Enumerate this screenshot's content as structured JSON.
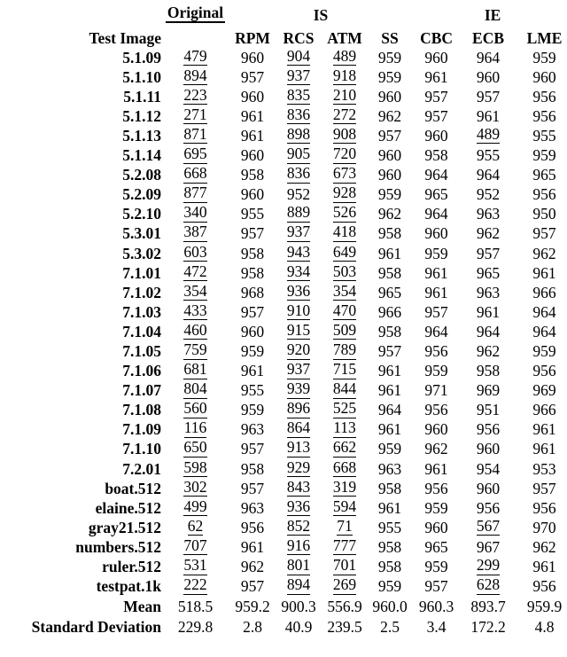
{
  "table": {
    "row_header_label": "Test Image",
    "group_headers": [
      {
        "key": "original",
        "label": "Original",
        "span": 1,
        "underlined": true
      },
      {
        "key": "is",
        "label": "IS",
        "span": 4,
        "underlined": false
      },
      {
        "key": "ie",
        "label": "IE",
        "span": 3,
        "underlined": false
      }
    ],
    "columns": [
      {
        "key": "original",
        "label": ""
      },
      {
        "key": "rpm",
        "label": "RPM"
      },
      {
        "key": "rcs",
        "label": "RCS"
      },
      {
        "key": "atm",
        "label": "ATM"
      },
      {
        "key": "ss",
        "label": "SS"
      },
      {
        "key": "cbc",
        "label": "CBC"
      },
      {
        "key": "ecb",
        "label": "ECB"
      },
      {
        "key": "lme",
        "label": "LME"
      }
    ],
    "rows": [
      {
        "name": "5.1.09",
        "original": "479",
        "rpm": "960",
        "rcs": "904",
        "atm": "489",
        "ss": "959",
        "cbc": "960",
        "ecb": "964",
        "lme": "959"
      },
      {
        "name": "5.1.10",
        "original": "894",
        "rpm": "957",
        "rcs": "937",
        "atm": "918",
        "ss": "959",
        "cbc": "961",
        "ecb": "960",
        "lme": "960"
      },
      {
        "name": "5.1.11",
        "original": "223",
        "rpm": "960",
        "rcs": "835",
        "atm": "210",
        "ss": "960",
        "cbc": "957",
        "ecb": "957",
        "lme": "956"
      },
      {
        "name": "5.1.12",
        "original": "271",
        "rpm": "961",
        "rcs": "836",
        "atm": "272",
        "ss": "962",
        "cbc": "957",
        "ecb": "961",
        "lme": "956"
      },
      {
        "name": "5.1.13",
        "original": "871",
        "rpm": "961",
        "rcs": "898",
        "atm": "908",
        "ss": "957",
        "cbc": "960",
        "ecb": "489",
        "lme": "955"
      },
      {
        "name": "5.1.14",
        "original": "695",
        "rpm": "960",
        "rcs": "905",
        "atm": "720",
        "ss": "960",
        "cbc": "958",
        "ecb": "955",
        "lme": "959"
      },
      {
        "name": "5.2.08",
        "original": "668",
        "rpm": "958",
        "rcs": "836",
        "atm": "673",
        "ss": "960",
        "cbc": "964",
        "ecb": "964",
        "lme": "965"
      },
      {
        "name": "5.2.09",
        "original": "877",
        "rpm": "960",
        "rcs": "952",
        "atm": "928",
        "ss": "959",
        "cbc": "965",
        "ecb": "952",
        "lme": "956"
      },
      {
        "name": "5.2.10",
        "original": "340",
        "rpm": "955",
        "rcs": "889",
        "atm": "526",
        "ss": "962",
        "cbc": "964",
        "ecb": "963",
        "lme": "950"
      },
      {
        "name": "5.3.01",
        "original": "387",
        "rpm": "957",
        "rcs": "937",
        "atm": "418",
        "ss": "958",
        "cbc": "960",
        "ecb": "962",
        "lme": "957"
      },
      {
        "name": "5.3.02",
        "original": "603",
        "rpm": "958",
        "rcs": "943",
        "atm": "649",
        "ss": "961",
        "cbc": "959",
        "ecb": "957",
        "lme": "962"
      },
      {
        "name": "7.1.01",
        "original": "472",
        "rpm": "958",
        "rcs": "934",
        "atm": "503",
        "ss": "958",
        "cbc": "961",
        "ecb": "965",
        "lme": "961"
      },
      {
        "name": "7.1.02",
        "original": "354",
        "rpm": "968",
        "rcs": "936",
        "atm": "354",
        "ss": "965",
        "cbc": "961",
        "ecb": "963",
        "lme": "966"
      },
      {
        "name": "7.1.03",
        "original": "433",
        "rpm": "957",
        "rcs": "910",
        "atm": "470",
        "ss": "966",
        "cbc": "957",
        "ecb": "961",
        "lme": "964"
      },
      {
        "name": "7.1.04",
        "original": "460",
        "rpm": "960",
        "rcs": "915",
        "atm": "509",
        "ss": "958",
        "cbc": "964",
        "ecb": "964",
        "lme": "964"
      },
      {
        "name": "7.1.05",
        "original": "759",
        "rpm": "959",
        "rcs": "920",
        "atm": "789",
        "ss": "957",
        "cbc": "956",
        "ecb": "962",
        "lme": "959"
      },
      {
        "name": "7.1.06",
        "original": "681",
        "rpm": "961",
        "rcs": "937",
        "atm": "715",
        "ss": "961",
        "cbc": "959",
        "ecb": "958",
        "lme": "956"
      },
      {
        "name": "7.1.07",
        "original": "804",
        "rpm": "955",
        "rcs": "939",
        "atm": "844",
        "ss": "961",
        "cbc": "971",
        "ecb": "969",
        "lme": "969"
      },
      {
        "name": "7.1.08",
        "original": "560",
        "rpm": "959",
        "rcs": "896",
        "atm": "525",
        "ss": "964",
        "cbc": "956",
        "ecb": "951",
        "lme": "966"
      },
      {
        "name": "7.1.09",
        "original": "116",
        "rpm": "963",
        "rcs": "864",
        "atm": "113",
        "ss": "961",
        "cbc": "960",
        "ecb": "956",
        "lme": "961"
      },
      {
        "name": "7.1.10",
        "original": "650",
        "rpm": "957",
        "rcs": "913",
        "atm": "662",
        "ss": "959",
        "cbc": "962",
        "ecb": "960",
        "lme": "961"
      },
      {
        "name": "7.2.01",
        "original": "598",
        "rpm": "958",
        "rcs": "929",
        "atm": "668",
        "ss": "963",
        "cbc": "961",
        "ecb": "954",
        "lme": "953"
      },
      {
        "name": "boat.512",
        "original": "302",
        "rpm": "957",
        "rcs": "843",
        "atm": "319",
        "ss": "958",
        "cbc": "956",
        "ecb": "960",
        "lme": "957"
      },
      {
        "name": "elaine.512",
        "original": "499",
        "rpm": "963",
        "rcs": "936",
        "atm": "594",
        "ss": "961",
        "cbc": "959",
        "ecb": "956",
        "lme": "956"
      },
      {
        "name": "gray21.512",
        "original": "62",
        "rpm": "956",
        "rcs": "852",
        "atm": "71",
        "ss": "955",
        "cbc": "960",
        "ecb": "567",
        "lme": "970"
      },
      {
        "name": "numbers.512",
        "original": "707",
        "rpm": "961",
        "rcs": "916",
        "atm": "777",
        "ss": "958",
        "cbc": "965",
        "ecb": "967",
        "lme": "962"
      },
      {
        "name": "ruler.512",
        "original": "531",
        "rpm": "962",
        "rcs": "801",
        "atm": "701",
        "ss": "958",
        "cbc": "959",
        "ecb": "299",
        "lme": "961"
      },
      {
        "name": "testpat.1k",
        "original": "222",
        "rpm": "957",
        "rcs": "894",
        "atm": "269",
        "ss": "959",
        "cbc": "957",
        "ecb": "628",
        "lme": "956"
      }
    ],
    "underlined_cells": {
      "original": [
        "5.1.09",
        "5.1.10",
        "5.1.11",
        "5.1.12",
        "5.1.13",
        "5.1.14",
        "5.2.08",
        "5.2.09",
        "5.2.10",
        "5.3.01",
        "5.3.02",
        "7.1.01",
        "7.1.02",
        "7.1.03",
        "7.1.04",
        "7.1.05",
        "7.1.06",
        "7.1.07",
        "7.1.08",
        "7.1.09",
        "7.1.10",
        "7.2.01",
        "boat.512",
        "elaine.512",
        "gray21.512",
        "numbers.512",
        "ruler.512",
        "testpat.1k"
      ],
      "rcs": [
        "5.1.09",
        "5.1.10",
        "5.1.11",
        "5.1.12",
        "5.1.13",
        "5.1.14",
        "5.2.08",
        "5.2.10",
        "5.3.01",
        "5.3.02",
        "7.1.01",
        "7.1.02",
        "7.1.03",
        "7.1.04",
        "7.1.05",
        "7.1.06",
        "7.1.07",
        "7.1.08",
        "7.1.09",
        "7.1.10",
        "7.2.01",
        "boat.512",
        "elaine.512",
        "gray21.512",
        "numbers.512",
        "ruler.512",
        "testpat.1k"
      ],
      "atm": [
        "5.1.09",
        "5.1.10",
        "5.1.11",
        "5.1.12",
        "5.1.13",
        "5.1.14",
        "5.2.08",
        "5.2.09",
        "5.2.10",
        "5.3.01",
        "5.3.02",
        "7.1.01",
        "7.1.02",
        "7.1.03",
        "7.1.04",
        "7.1.05",
        "7.1.06",
        "7.1.07",
        "7.1.08",
        "7.1.09",
        "7.1.10",
        "7.2.01",
        "boat.512",
        "elaine.512",
        "gray21.512",
        "numbers.512",
        "ruler.512",
        "testpat.1k"
      ],
      "ecb": [
        "5.1.13",
        "gray21.512",
        "ruler.512",
        "testpat.1k"
      ]
    },
    "summary_rows": [
      {
        "name": "Mean",
        "original": "518.5",
        "rpm": "959.2",
        "rcs": "900.3",
        "atm": "556.9",
        "ss": "960.0",
        "cbc": "960.3",
        "ecb": "893.7",
        "lme": "959.9"
      },
      {
        "name": "Standard Deviation",
        "original": "229.8",
        "rpm": "2.8",
        "rcs": "40.9",
        "atm": "239.5",
        "ss": "2.5",
        "cbc": "3.4",
        "ecb": "172.2",
        "lme": "4.8"
      }
    ]
  }
}
